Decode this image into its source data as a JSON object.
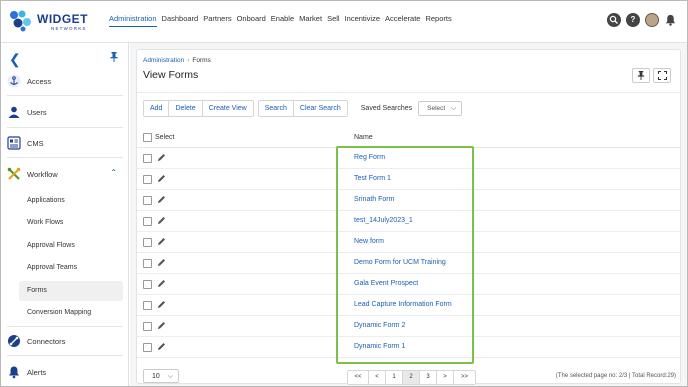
{
  "brand": {
    "name": "WIDGET",
    "sub": "NETWORKS"
  },
  "nav": [
    "Administration",
    "Dashboard",
    "Partners",
    "Onboard",
    "Enable",
    "Market",
    "Sell",
    "Incentivize",
    "Accelerate",
    "Reports"
  ],
  "top_icons": {
    "help": "?"
  },
  "sidebar": {
    "items": [
      {
        "label": "Access"
      },
      {
        "label": "Users"
      },
      {
        "label": "CMS"
      },
      {
        "label": "Workflow"
      },
      {
        "label": "Connectors"
      },
      {
        "label": "Alerts"
      }
    ],
    "workflow_sub": [
      "Applications",
      "Work Flows",
      "Approval Flows",
      "Approval Teams",
      "Forms",
      "Conversion Mapping"
    ]
  },
  "breadcrumb": {
    "parent": "Administration",
    "current": "Forms"
  },
  "page_title": "View Forms",
  "toolbar": {
    "add": "Add",
    "delete": "Delete",
    "create_view": "Create View",
    "search": "Search",
    "clear_search": "Clear Search",
    "saved_searches_label": "Saved Searches",
    "select_placeholder": "Select"
  },
  "table": {
    "select_header": "Select",
    "name_header": "Name",
    "rows": [
      "Reg Form",
      "Test Form 1",
      "Srinath Form",
      "test_14July2023_1",
      "New form",
      "Demo Form for UCM Training",
      "Gala Event Prospect",
      "Lead Capture Information Form",
      "Dynamic Form 2",
      "Dynamic Form 1"
    ]
  },
  "pagination": {
    "page_size": "10",
    "first": "<<",
    "prev": "<",
    "pages": [
      "1",
      "2",
      "3"
    ],
    "next": ">",
    "last": ">>",
    "info": "(The selected page no: 2/3 | Total Record:29)"
  },
  "colors": {
    "accent": "#1a5fb4",
    "highlight": "#7cc04a"
  }
}
